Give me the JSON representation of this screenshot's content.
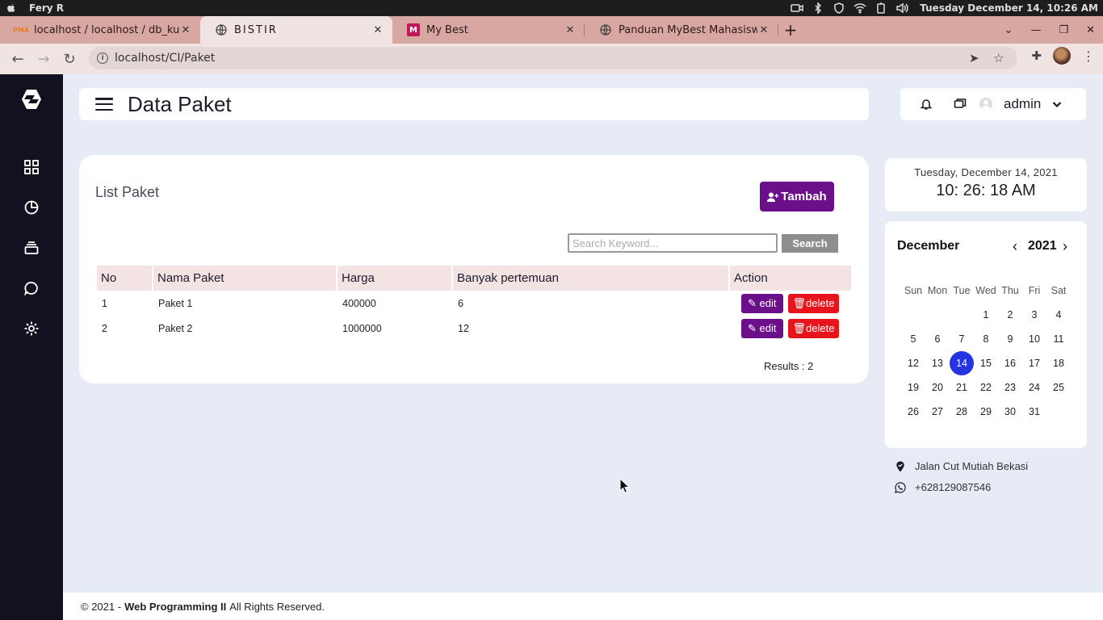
{
  "os": {
    "user": "Fery R",
    "datetime": "Tuesday December 14, 10:26 AM"
  },
  "browser": {
    "tabs": [
      {
        "title": "localhost / localhost / db_kur",
        "icon": "phpmyadmin-icon"
      },
      {
        "title": "BISTIR",
        "icon": "globe-icon"
      },
      {
        "title": "My Best",
        "icon": "mybest-icon"
      },
      {
        "title": "Panduan MyBest Mahasiswa.p",
        "icon": "globe-icon"
      }
    ],
    "url": "localhost/CI/Paket"
  },
  "header": {
    "title": "Data Paket",
    "username": "admin"
  },
  "main": {
    "list_title": "List Paket",
    "add_label": "Tambah",
    "search_placeholder": "Search Keyword...",
    "search_label": "Search",
    "table": {
      "headers": [
        "No",
        "Nama Paket",
        "Harga",
        "Banyak pertemuan",
        "Action"
      ],
      "rows": [
        {
          "no": "1",
          "nama": "Paket 1",
          "harga": "400000",
          "pertemuan": "6"
        },
        {
          "no": "2",
          "nama": "Paket 2",
          "harga": "1000000",
          "pertemuan": "12"
        }
      ],
      "edit_label": "edit",
      "delete_label": "delete"
    },
    "results": "Results : 2"
  },
  "widgets": {
    "date": "Tuesday, December 14, 2021",
    "time": "10: 26: 18 AM",
    "calendar": {
      "month": "December",
      "year": "2021",
      "prev": "‹",
      "next": "›",
      "weekdays": [
        "Sun",
        "Mon",
        "Tue",
        "Wed",
        "Thu",
        "Fri",
        "Sat"
      ],
      "days": [
        "",
        "",
        "",
        "1",
        "2",
        "3",
        "4",
        "5",
        "6",
        "7",
        "8",
        "9",
        "10",
        "11",
        "12",
        "13",
        "14",
        "15",
        "16",
        "17",
        "18",
        "19",
        "20",
        "21",
        "22",
        "23",
        "24",
        "25",
        "26",
        "27",
        "28",
        "29",
        "30",
        "31"
      ],
      "today": "14"
    },
    "address": "Jalan Cut Mutiah Bekasi",
    "phone": "+628129087546"
  },
  "footer": {
    "prefix": "© 2021 -",
    "brand": "Web Programming II",
    "suffix": "All Rights Reserved."
  },
  "colors": {
    "sidebar": "#11111f",
    "primary": "#6b0f8a",
    "danger": "#e8141b",
    "today": "#2534e2",
    "tab_bar": "#d9a7a1"
  }
}
